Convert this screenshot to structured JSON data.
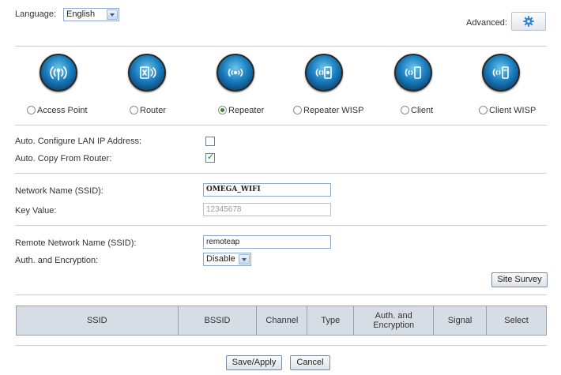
{
  "language": {
    "label": "Language:",
    "value": "English"
  },
  "advanced": {
    "label": "Advanced:",
    "icon": "gear-icon"
  },
  "modes": [
    {
      "label": "Access Point",
      "icon": "wifi-broadcast-icon",
      "selected": false
    },
    {
      "label": "Router",
      "icon": "router-wifi-icon",
      "selected": false
    },
    {
      "label": "Repeater",
      "icon": "repeater-icon",
      "selected": true
    },
    {
      "label": "Repeater WISP",
      "icon": "repeater-wisp-icon",
      "selected": false
    },
    {
      "label": "Client",
      "icon": "client-icon",
      "selected": false
    },
    {
      "label": "Client WISP",
      "icon": "client-wisp-icon",
      "selected": false
    }
  ],
  "lan": {
    "auto_configure_label": "Auto. Configure LAN IP Address:",
    "auto_configure_checked": false,
    "auto_copy_label": "Auto. Copy From Router:",
    "auto_copy_checked": true
  },
  "network": {
    "ssid_label": "Network Name (SSID):",
    "ssid_value": "OMEGA_WIFI",
    "key_label": "Key Value:",
    "key_value": "12345678"
  },
  "remote": {
    "ssid_label": "Remote Network Name (SSID):",
    "ssid_value": "remoteap",
    "auth_label": "Auth. and Encryption:",
    "auth_value": "Disable"
  },
  "site_survey_label": "Site Survey",
  "table": {
    "columns": [
      "SSID",
      "BSSID",
      "Channel",
      "Type",
      "Auth. and Encryption",
      "Signal",
      "Select"
    ]
  },
  "buttons": {
    "save": "Save/Apply",
    "cancel": "Cancel"
  },
  "colors": {
    "icon_blue": "#1b7fc0",
    "header_gray": "#d7dde4",
    "selected_radio": "#2a8a2a"
  }
}
